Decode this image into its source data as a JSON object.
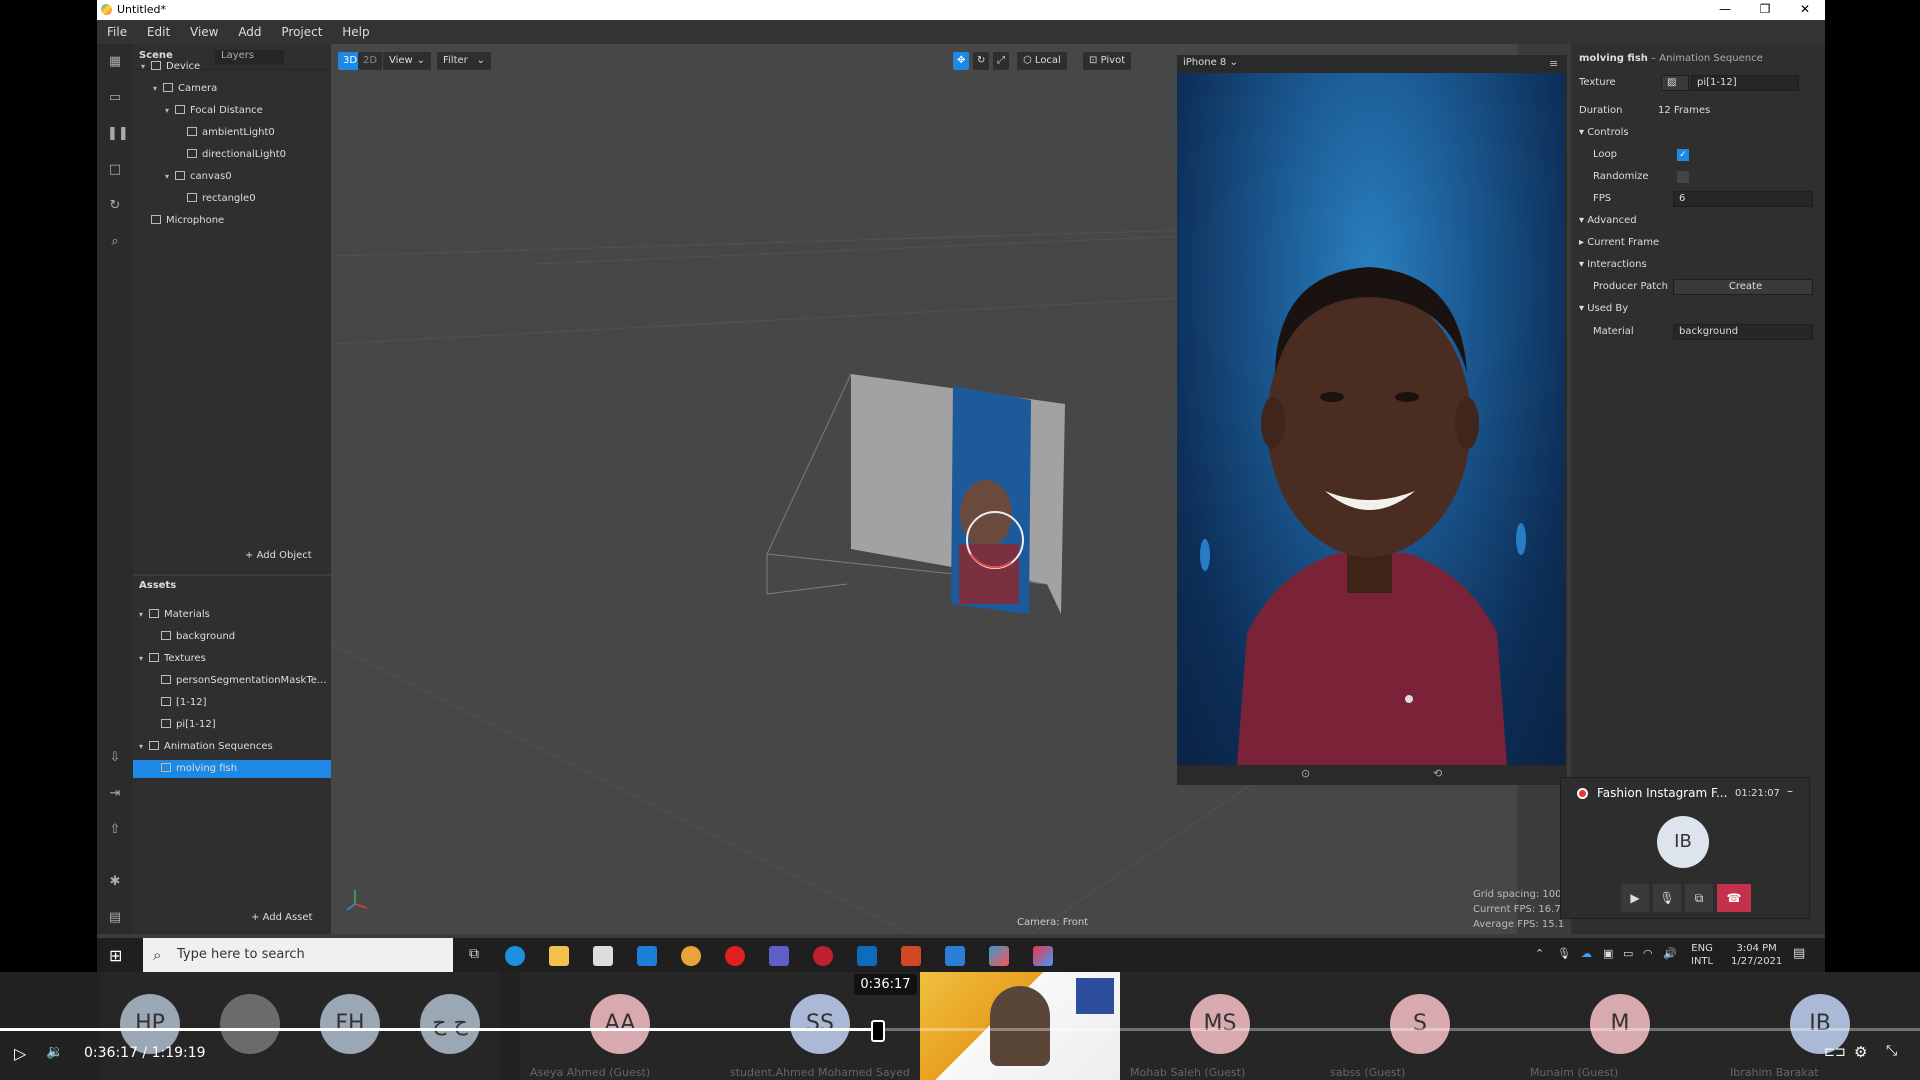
{
  "window": {
    "title": "Untitled*",
    "controls": [
      "—",
      "❐",
      "✕"
    ]
  },
  "menu": [
    "File",
    "Edit",
    "View",
    "Add",
    "Project",
    "Help"
  ],
  "scene": {
    "tabs": [
      "Scene",
      "Layers"
    ],
    "tree": [
      {
        "label": "Device",
        "depth": 0,
        "caret": true
      },
      {
        "label": "Camera",
        "depth": 1,
        "caret": true
      },
      {
        "label": "Focal Distance",
        "depth": 2,
        "caret": true
      },
      {
        "label": "ambientLight0",
        "depth": 3,
        "caret": false
      },
      {
        "label": "directionalLight0",
        "depth": 3,
        "caret": false
      },
      {
        "label": "canvas0",
        "depth": 2,
        "caret": true
      },
      {
        "label": "rectangle0",
        "depth": 3,
        "caret": false
      },
      {
        "label": "Microphone",
        "depth": 0,
        "caret": false
      }
    ],
    "add_object": "Add Object"
  },
  "assets": {
    "title": "Assets",
    "tree": [
      {
        "label": "Materials",
        "depth": 0,
        "caret": true,
        "selected": false
      },
      {
        "label": "background",
        "depth": 1,
        "caret": false,
        "selected": false
      },
      {
        "label": "Textures",
        "depth": 0,
        "caret": true,
        "selected": false
      },
      {
        "label": "personSegmentationMaskTe...",
        "depth": 1,
        "caret": false,
        "selected": false
      },
      {
        "label": "[1-12]",
        "depth": 1,
        "caret": false,
        "selected": false
      },
      {
        "label": "pi[1-12]",
        "depth": 1,
        "caret": false,
        "selected": false
      },
      {
        "label": "Animation Sequences",
        "depth": 0,
        "caret": true,
        "selected": false
      },
      {
        "label": "molving fish",
        "depth": 1,
        "caret": false,
        "selected": true
      }
    ],
    "add_asset": "Add Asset"
  },
  "viewport": {
    "mode_3d": "3D",
    "mode_2d": "2D",
    "view": "View",
    "filter": "Filter",
    "local": "Local",
    "pivot": "Pivot",
    "camera_label": "Camera: Front",
    "stats": [
      "Grid spacing: 100cm",
      "Current FPS: 16.7",
      "Average FPS: 15.1"
    ]
  },
  "preview": {
    "device": "iPhone 8"
  },
  "inspector": {
    "name": "molving fish",
    "type": "– Animation Sequence",
    "texture_label": "Texture",
    "texture_value": "pi[1-12]",
    "duration_label": "Duration",
    "duration_value": "12 Frames",
    "controls": "Controls",
    "loop": "Loop",
    "randomize": "Randomize",
    "fps_label": "FPS",
    "fps_value": "6",
    "advanced": "Advanced",
    "current_frame": "Current Frame",
    "interactions": "Interactions",
    "producer_patch": "Producer Patch",
    "create": "Create",
    "used_by": "Used By",
    "material_label": "Material",
    "material_value": "background"
  },
  "taskbar": {
    "search_placeholder": "Type here to search",
    "lang": "ENG",
    "lang2": "INTL",
    "time": "3:04 PM",
    "date": "1/27/2021"
  },
  "call": {
    "title": "Fashion Instagram F...",
    "duration": "01:21:07",
    "initials": "IB"
  },
  "meeting": {
    "tiles": [
      {
        "initials": "HP",
        "name": "",
        "color": "#9aa7b4"
      },
      {
        "initials": "",
        "name": "",
        "color": "#6b6b6b"
      },
      {
        "initials": "FH",
        "name": "",
        "color": "#9aa7b4"
      },
      {
        "initials": "ح ج",
        "name": "",
        "color": "#9aa7b4"
      },
      {
        "initials": "AA",
        "name": "Aseya Ahmed (Guest)",
        "color": "#d9a9b0"
      },
      {
        "initials": "SS",
        "name": "student.Ahmed Mohamed Sayed",
        "color": "#a9b9d6"
      },
      {
        "initials": "MS",
        "name": "Mohab Saleh (Guest)",
        "color": "#d9a9b0"
      },
      {
        "initials": "S",
        "name": "sabss (Guest)",
        "color": "#d9a9b0"
      },
      {
        "initials": "M",
        "name": "Munaim (Guest)",
        "color": "#d9a9b0"
      },
      {
        "initials": "IB",
        "name": "Ibrahim Barakat",
        "color": "#a9b9d6"
      }
    ]
  },
  "player": {
    "current": "0:36:17",
    "total": "1:19:19",
    "tooltip": "0:36:17",
    "progress": 0.4575
  }
}
